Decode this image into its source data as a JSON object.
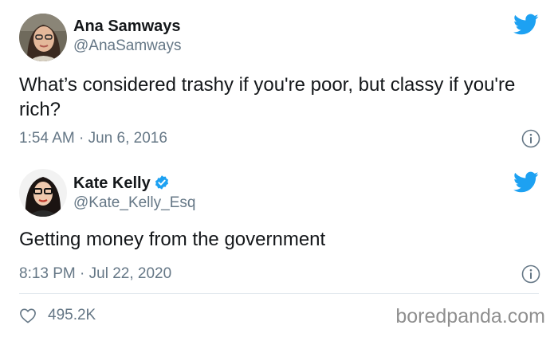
{
  "tweets": [
    {
      "name": "Ana Samways",
      "handle": "@AnaSamways",
      "verified": false,
      "text": "What’s considered trashy if you're poor, but classy if you're rich?",
      "timestamp": "1:54 AM · Jun 6, 2016"
    },
    {
      "name": "Kate Kelly",
      "handle": "@Kate_Kelly_Esq",
      "verified": true,
      "text": "Getting money from the government",
      "timestamp": "8:13 PM · Jul 22, 2020",
      "likes": "495.2K"
    }
  ],
  "watermark": "boredpanda.com",
  "colors": {
    "twitter_blue": "#1da1f2",
    "secondary_text": "#657786",
    "primary_text": "#14171a",
    "divider": "#e1e8ed"
  },
  "icons": {
    "brand": "twitter-bird-icon",
    "info": "info-icon",
    "like": "heart-icon",
    "verified": "verified-badge-icon"
  }
}
